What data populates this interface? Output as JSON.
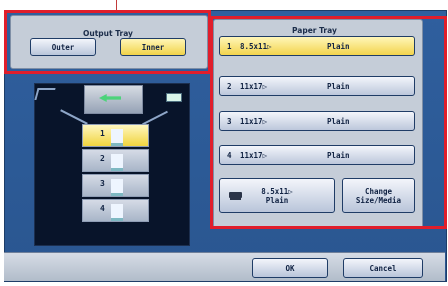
{
  "output_tray": {
    "title": "Output Tray",
    "outer_label": "Outer",
    "inner_label": "Inner",
    "selected": "Inner"
  },
  "paper_tray": {
    "title": "Paper Tray",
    "trays": [
      {
        "number": "1",
        "size": "8.5x11▷",
        "type": "Plain",
        "selected": true
      },
      {
        "number": "2",
        "size": "11x17▷",
        "type": "Plain",
        "selected": false
      },
      {
        "number": "3",
        "size": "11x17▷",
        "type": "Plain",
        "selected": false
      },
      {
        "number": "4",
        "size": "11x17▷",
        "type": "Plain",
        "selected": false
      }
    ],
    "bypass": {
      "size": "8.5x11▷",
      "type": "Plain"
    },
    "change_label_line1": "Change",
    "change_label_line2": "Size/Media"
  },
  "machine": {
    "bins": [
      {
        "label": "1",
        "selected": true
      },
      {
        "label": "2",
        "selected": false
      },
      {
        "label": "3",
        "selected": false
      },
      {
        "label": "4",
        "selected": false
      }
    ]
  },
  "footer": {
    "ok_label": "OK",
    "cancel_label": "Cancel"
  },
  "colors": {
    "highlight_box": "#e01e2b",
    "selected_fill": "#f1d349",
    "screen_bg": "#2f5f9e"
  }
}
